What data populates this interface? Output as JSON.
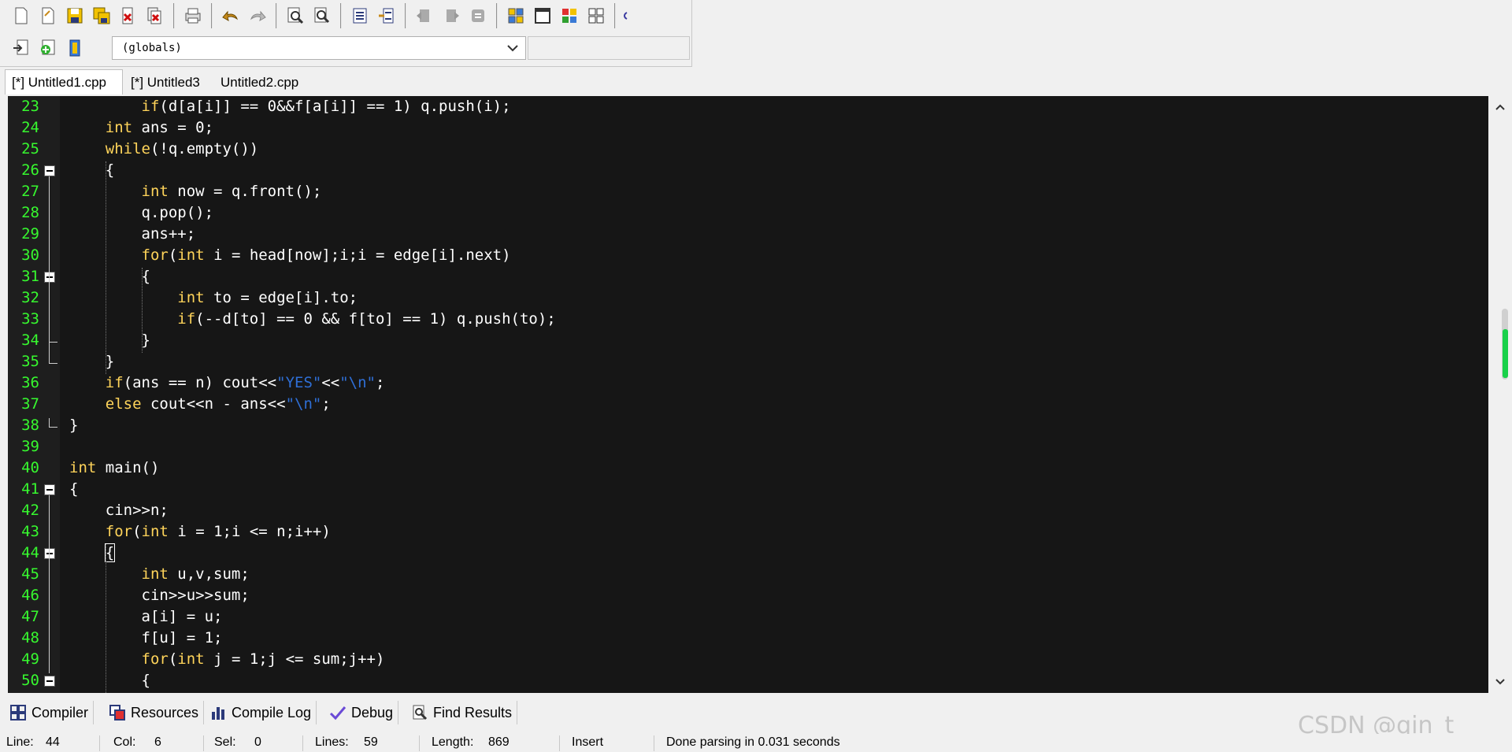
{
  "toolbar": {
    "row1_icons": [
      "new-file-icon",
      "open-file-icon",
      "save-icon",
      "save-all-icon",
      "close-icon",
      "close-all-icon",
      "print-icon",
      "undo-icon",
      "redo-icon",
      "find-icon",
      "replace-icon",
      "indent-icon",
      "unindent-icon",
      "bookmark-prev-icon",
      "bookmark-next-icon",
      "toggle-bookmark-icon",
      "project-icon",
      "window-icon",
      "class-browser-icon",
      "grid-icon"
    ],
    "row2_icons": [
      "insert-icon",
      "add-to-project-icon",
      "remove-from-project-icon"
    ],
    "scope_combo_value": "(globals)"
  },
  "tabs": [
    {
      "label": "[*] Untitled1.cpp",
      "active": true
    },
    {
      "label": "[*] Untitled3",
      "active": false
    },
    {
      "label": "Untitled2.cpp",
      "active": false
    }
  ],
  "editor": {
    "lines": [
      {
        "num": "23",
        "code": [
          [
            "        ",
            ""
          ],
          [
            "if",
            "kw"
          ],
          [
            "(d[a[i]] == 0&&f[a[i]] == 1) q.push(i);",
            ""
          ]
        ]
      },
      {
        "num": "24",
        "code": [
          [
            "    ",
            ""
          ],
          [
            "int",
            "kw"
          ],
          [
            " ans = 0;",
            ""
          ]
        ]
      },
      {
        "num": "25",
        "code": [
          [
            "    ",
            ""
          ],
          [
            "while",
            "kw"
          ],
          [
            "(!q.empty())",
            ""
          ]
        ]
      },
      {
        "num": "26",
        "code": [
          [
            "    {",
            ""
          ]
        ],
        "fold": "open"
      },
      {
        "num": "27",
        "code": [
          [
            "        ",
            ""
          ],
          [
            "int",
            "kw"
          ],
          [
            " now = q.front();",
            ""
          ]
        ]
      },
      {
        "num": "28",
        "code": [
          [
            "        q.pop();",
            ""
          ]
        ]
      },
      {
        "num": "29",
        "code": [
          [
            "        ans++;",
            ""
          ]
        ]
      },
      {
        "num": "30",
        "code": [
          [
            "        ",
            ""
          ],
          [
            "for",
            "kw"
          ],
          [
            "(",
            ""
          ],
          [
            "int",
            "kw"
          ],
          [
            " i = head[now];i;i = edge[i].next)",
            ""
          ]
        ]
      },
      {
        "num": "31",
        "code": [
          [
            "        {",
            ""
          ]
        ],
        "fold": "open"
      },
      {
        "num": "32",
        "code": [
          [
            "            ",
            ""
          ],
          [
            "int",
            "kw"
          ],
          [
            " to = edge[i].to;",
            ""
          ]
        ]
      },
      {
        "num": "33",
        "code": [
          [
            "            ",
            ""
          ],
          [
            "if",
            "kw"
          ],
          [
            "(--d[to] == 0 && f[to] == 1) q.push(to);",
            ""
          ]
        ]
      },
      {
        "num": "34",
        "code": [
          [
            "        }",
            ""
          ]
        ],
        "fold": "end"
      },
      {
        "num": "35",
        "code": [
          [
            "    }",
            ""
          ]
        ],
        "fold": "end"
      },
      {
        "num": "36",
        "code": [
          [
            "    ",
            ""
          ],
          [
            "if",
            "kw"
          ],
          [
            "(ans == n) cout<<",
            ""
          ],
          [
            "\"YES\"",
            "str"
          ],
          [
            "<<",
            ""
          ],
          [
            "\"\\n\"",
            "str"
          ],
          [
            ";",
            ""
          ]
        ]
      },
      {
        "num": "37",
        "code": [
          [
            "    ",
            ""
          ],
          [
            "else",
            "kw"
          ],
          [
            " cout<<n - ans<<",
            ""
          ],
          [
            "\"\\n\"",
            "str"
          ],
          [
            ";",
            ""
          ]
        ]
      },
      {
        "num": "38",
        "code": [
          [
            "}",
            ""
          ]
        ],
        "fold": "end"
      },
      {
        "num": "39",
        "code": []
      },
      {
        "num": "40",
        "code": [
          [
            "int",
            "kw"
          ],
          [
            " main()",
            ""
          ]
        ]
      },
      {
        "num": "41",
        "code": [
          [
            "{",
            ""
          ]
        ],
        "fold": "open"
      },
      {
        "num": "42",
        "code": [
          [
            "    cin>>n;",
            ""
          ]
        ]
      },
      {
        "num": "43",
        "code": [
          [
            "    ",
            ""
          ],
          [
            "for",
            "kw"
          ],
          [
            "(",
            ""
          ],
          [
            "int",
            "kw"
          ],
          [
            " i = 1;i <= n;i++)",
            ""
          ]
        ]
      },
      {
        "num": "44",
        "code": [
          [
            "    ",
            ""
          ],
          [
            "{",
            "cursor"
          ]
        ],
        "fold": "open"
      },
      {
        "num": "45",
        "code": [
          [
            "        ",
            ""
          ],
          [
            "int",
            "kw"
          ],
          [
            " u,v,sum;",
            ""
          ]
        ]
      },
      {
        "num": "46",
        "code": [
          [
            "        cin>>u>>sum;",
            ""
          ]
        ]
      },
      {
        "num": "47",
        "code": [
          [
            "        a[i] = u;",
            ""
          ]
        ]
      },
      {
        "num": "48",
        "code": [
          [
            "        f[u] = 1;",
            ""
          ]
        ]
      },
      {
        "num": "49",
        "code": [
          [
            "        ",
            ""
          ],
          [
            "for",
            "kw"
          ],
          [
            "(",
            ""
          ],
          [
            "int",
            "kw"
          ],
          [
            " j = 1;j <= sum;j++)",
            ""
          ]
        ]
      },
      {
        "num": "50",
        "code": [
          [
            "        {",
            ""
          ]
        ],
        "fold": "open"
      }
    ]
  },
  "panel_tabs": [
    {
      "label": "Compiler",
      "icon": "compiler-grid-icon"
    },
    {
      "label": "Resources",
      "icon": "resources-icon"
    },
    {
      "label": "Compile Log",
      "icon": "compile-log-chart-icon"
    },
    {
      "label": "Debug",
      "icon": "debug-check-icon"
    },
    {
      "label": "Find Results",
      "icon": "find-results-icon"
    }
  ],
  "status": {
    "line_label": "Line:",
    "line_value": "44",
    "col_label": "Col:",
    "col_value": "6",
    "sel_label": "Sel:",
    "sel_value": "0",
    "lines_label": "Lines:",
    "lines_value": "59",
    "length_label": "Length:",
    "length_value": "869",
    "mode": "Insert",
    "message": "Done parsing in 0.031 seconds"
  },
  "watermark": "CSDN @qin_t",
  "colors": {
    "editor_bg": "#161616",
    "line_number": "#37f82f",
    "keyword": "#ffd45a",
    "string": "#2f6fd6",
    "default_text": "#ffffff"
  }
}
